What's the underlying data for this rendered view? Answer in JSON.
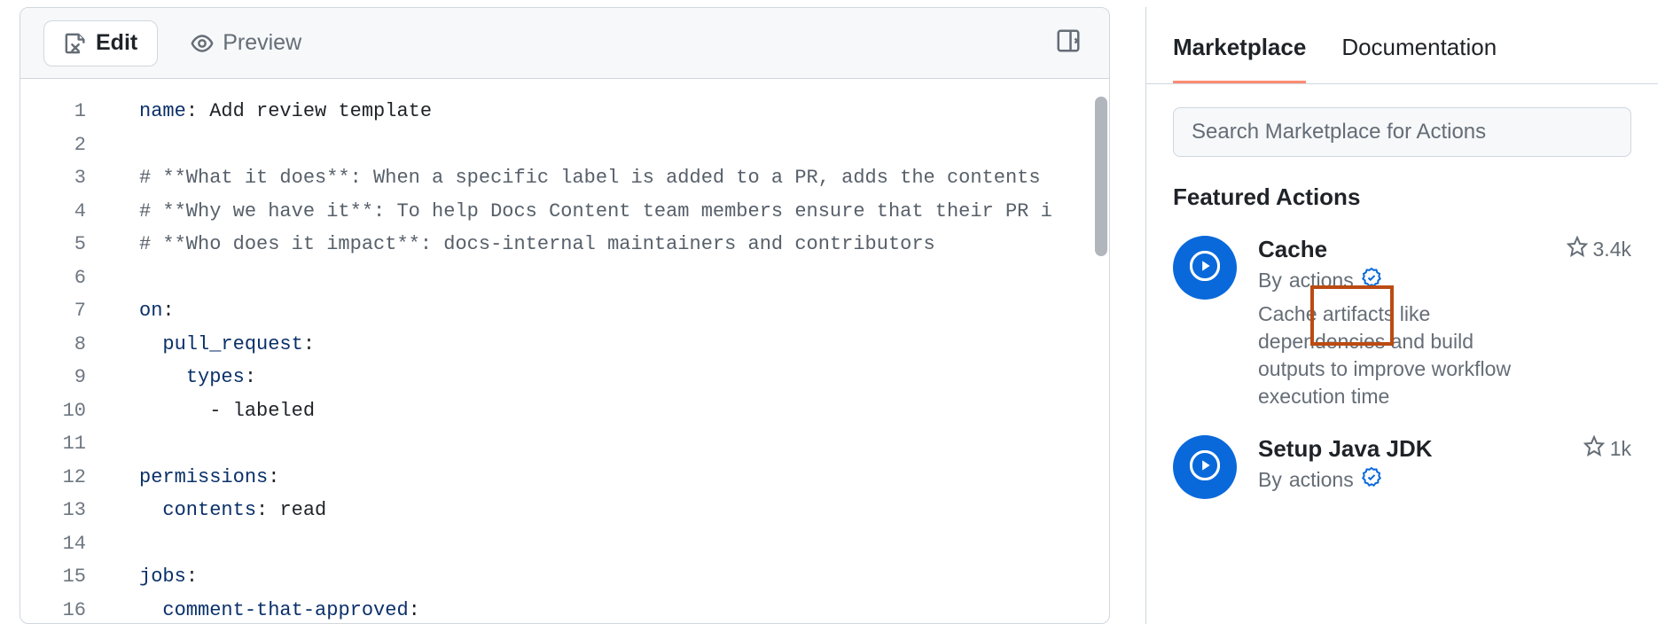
{
  "editor": {
    "tabs": {
      "edit": "Edit",
      "preview": "Preview"
    },
    "lines": [
      {
        "n": 1,
        "kind": "kv",
        "key": "name",
        "val": "Add review template",
        "indent": 0
      },
      {
        "n": 2,
        "kind": "blank"
      },
      {
        "n": 3,
        "kind": "comment",
        "text": "# **What it does**: When a specific label is added to a PR, adds the contents "
      },
      {
        "n": 4,
        "kind": "comment",
        "text": "# **Why we have it**: To help Docs Content team members ensure that their PR i"
      },
      {
        "n": 5,
        "kind": "comment",
        "text": "# **Who does it impact**: docs-internal maintainers and contributors"
      },
      {
        "n": 6,
        "kind": "blank"
      },
      {
        "n": 7,
        "kind": "key",
        "key": "on",
        "indent": 0
      },
      {
        "n": 8,
        "kind": "key",
        "key": "pull_request",
        "indent": 1
      },
      {
        "n": 9,
        "kind": "key",
        "key": "types",
        "indent": 2
      },
      {
        "n": 10,
        "kind": "item",
        "val": "labeled",
        "indent": 3
      },
      {
        "n": 11,
        "kind": "blank"
      },
      {
        "n": 12,
        "kind": "key",
        "key": "permissions",
        "indent": 0
      },
      {
        "n": 13,
        "kind": "kv",
        "key": "contents",
        "val": "read",
        "indent": 1
      },
      {
        "n": 14,
        "kind": "blank"
      },
      {
        "n": 15,
        "kind": "key",
        "key": "jobs",
        "indent": 0
      },
      {
        "n": 16,
        "kind": "key",
        "key": "comment-that-approved",
        "indent": 1
      }
    ]
  },
  "sidebar": {
    "tabs": {
      "marketplace": "Marketplace",
      "documentation": "Documentation"
    },
    "search_placeholder": "Search Marketplace for Actions",
    "section_title": "Featured Actions",
    "actions": [
      {
        "title": "Cache",
        "author_prefix": "By ",
        "author": "actions",
        "stars": "3.4k",
        "desc": "Cache artifacts like dependencies and build outputs to improve workflow execution time"
      },
      {
        "title": "Setup Java JDK",
        "author_prefix": "By ",
        "author": "actions",
        "stars": "1k",
        "desc": ""
      }
    ]
  }
}
